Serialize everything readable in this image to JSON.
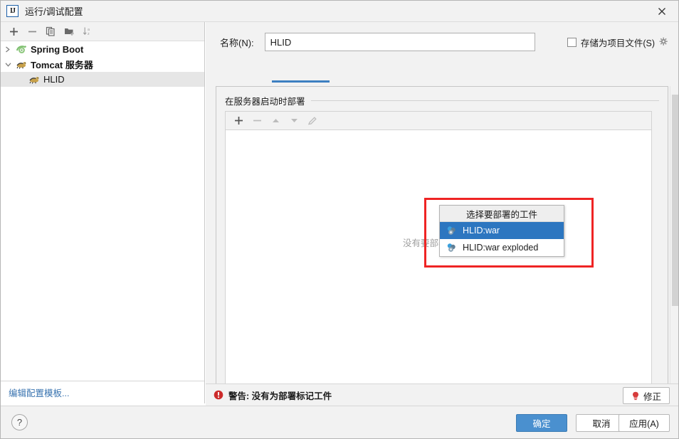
{
  "window": {
    "title": "运行/调试配置",
    "logo_text": "IJ",
    "close_label": "✕"
  },
  "left_panel": {
    "toolbar": [
      {
        "name": "add-configuration-button",
        "glyph": "+"
      },
      {
        "name": "remove-configuration-button",
        "glyph": "−"
      },
      {
        "name": "copy-configuration-button",
        "glyph": "copy"
      },
      {
        "name": "new-folder-button",
        "glyph": "folder-add"
      },
      {
        "name": "sort-configurations-button",
        "glyph": "sort-az"
      }
    ],
    "tree": [
      {
        "label": "Spring Boot",
        "icon": "spring-boot-icon",
        "expanded": false,
        "depth": 0,
        "selected": false
      },
      {
        "label": "Tomcat 服务器",
        "icon": "tomcat-icon",
        "expanded": true,
        "depth": 0,
        "selected": false
      },
      {
        "label": "HLID",
        "icon": "tomcat-icon",
        "expanded": null,
        "depth": 1,
        "selected": true
      }
    ],
    "edit_templates_link": "编辑配置模板..."
  },
  "right_panel": {
    "name_label": "名称(N):",
    "name_value": "HLID",
    "name_placeholder": "",
    "store_as_project_file_label": "存储为项目文件(S)",
    "store_as_project_file_checked": false,
    "group_title": "在服务器启动时部署",
    "deploy_toolbar": [
      {
        "name": "add-artifact-button",
        "glyph": "+"
      },
      {
        "name": "remove-artifact-button",
        "glyph": "−"
      },
      {
        "name": "move-up-button",
        "glyph": "▲"
      },
      {
        "name": "move-down-button",
        "glyph": "▼"
      },
      {
        "name": "edit-artifact-button",
        "glyph": "pencil"
      }
    ],
    "empty_list_text": "没有要部署的内容"
  },
  "popup": {
    "header": "选择要部署的工件",
    "items": [
      {
        "label": "HLID:war",
        "selected": true
      },
      {
        "label": "HLID:war exploded",
        "selected": false
      }
    ]
  },
  "warning_bar": {
    "text": "警告: 没有为部署标记工件",
    "fix_button": "修正"
  },
  "bottom_bar": {
    "help_label": "?",
    "ok_label": "确定",
    "cancel_label": "取消",
    "apply_label": "应用(A)"
  },
  "colors": {
    "accent_blue": "#4a90cf",
    "tab_underline": "#3d7fc1",
    "selection_blue": "#2c76c0",
    "warning_red": "#cc2b2b",
    "annotation_red": "#ef2424",
    "link_blue": "#3a74b0",
    "tree_selection": "#e6e6e6"
  }
}
